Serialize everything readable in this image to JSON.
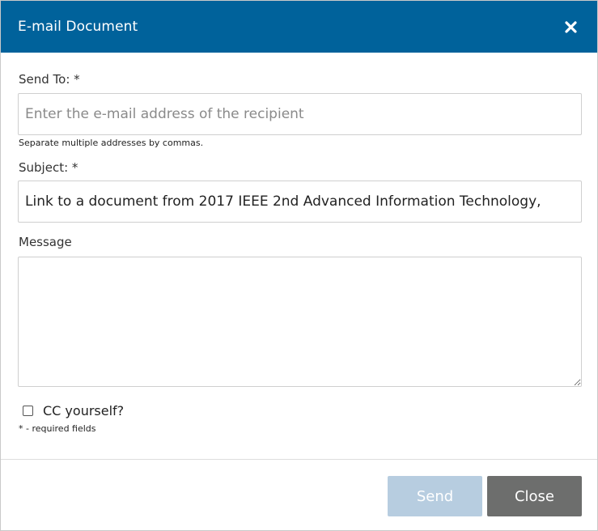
{
  "dialog": {
    "title": "E-mail Document",
    "close_icon": "close-x-icon"
  },
  "form": {
    "send_to": {
      "label": "Send To: *",
      "value": "",
      "placeholder": "Enter the e-mail address of the recipient",
      "hint": "Separate multiple addresses by commas."
    },
    "subject": {
      "label": "Subject: *",
      "value": "Link to a document from 2017 IEEE 2nd Advanced Information Technology,"
    },
    "message": {
      "label": "Message",
      "value": ""
    },
    "cc": {
      "label": "CC yourself?",
      "checked": false
    },
    "required_note": "* - required fields"
  },
  "buttons": {
    "send_label": "Send",
    "close_label": "Close"
  },
  "colors": {
    "header_bg": "#00629b",
    "send_button_disabled": "#b7cde0",
    "close_button": "#6d6e6d"
  }
}
